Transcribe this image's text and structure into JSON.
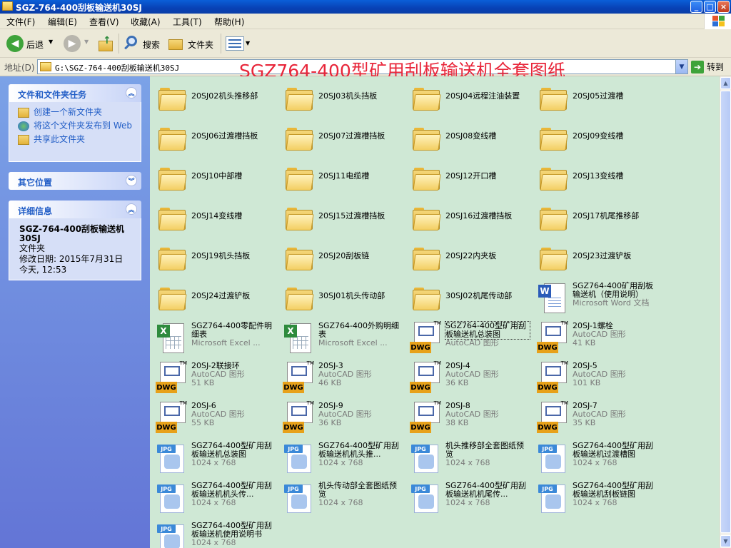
{
  "window": {
    "title": "SGZ-764-400刮板输送机30SJ",
    "minimize": "_",
    "maximize": "□",
    "close": "×"
  },
  "menu": [
    "文件(F)",
    "编辑(E)",
    "查看(V)",
    "收藏(A)",
    "工具(T)",
    "帮助(H)"
  ],
  "toolbar": {
    "back": "后退",
    "search": "搜索",
    "folders": "文件夹"
  },
  "address": {
    "label": "地址(D)",
    "path": "G:\\SGZ-764-400刮板输送机30SJ",
    "go": "转到"
  },
  "overlay_title": "SGZ764-400型矿用刮板输送机全套图纸",
  "taskpane": {
    "tasks_title": "文件和文件夹任务",
    "tasks": [
      "创建一个新文件夹",
      "将这个文件夹发布到 Web",
      "共享此文件夹"
    ],
    "other_title": "其它位置",
    "details_title": "详细信息",
    "details_name": "SGZ-764-400刮板输送机30SJ",
    "details_type": "文件夹",
    "details_modified": "修改日期: 2015年7月31日今天, 12:53"
  },
  "items": [
    {
      "type": "folder",
      "name": "20SJ02机头推移部"
    },
    {
      "type": "folder",
      "name": "20SJ03机头挡板"
    },
    {
      "type": "folder",
      "name": "20SJ04远程注油装置"
    },
    {
      "type": "folder",
      "name": "20SJ05过渡槽"
    },
    {
      "type": "folder",
      "name": "20SJ06过渡槽挡板"
    },
    {
      "type": "folder",
      "name": "20SJ07过渡槽挡板"
    },
    {
      "type": "folder",
      "name": "20SJ08变线槽"
    },
    {
      "type": "folder",
      "name": "20SJ09变线槽"
    },
    {
      "type": "folder",
      "name": "20SJ10中部槽"
    },
    {
      "type": "folder",
      "name": "20SJ11电缆槽"
    },
    {
      "type": "folder",
      "name": "20SJ12开口槽"
    },
    {
      "type": "folder",
      "name": "20SJ13变线槽"
    },
    {
      "type": "folder",
      "name": "20SJ14变线槽"
    },
    {
      "type": "folder",
      "name": "20SJ15过渡槽挡板"
    },
    {
      "type": "folder",
      "name": "20SJ16过渡槽挡板"
    },
    {
      "type": "folder",
      "name": "20SJ17机尾推移部"
    },
    {
      "type": "folder",
      "name": "20SJ19机头挡板"
    },
    {
      "type": "folder",
      "name": "20SJ20刮板链"
    },
    {
      "type": "folder",
      "name": "20SJ22内夹板"
    },
    {
      "type": "folder",
      "name": "20SJ23过渡铲板"
    },
    {
      "type": "folder",
      "name": "20SJ24过渡铲板"
    },
    {
      "type": "folder",
      "name": "30SJ01机头传动部"
    },
    {
      "type": "folder",
      "name": "30SJ02机尾传动部"
    },
    {
      "type": "doc",
      "name": "SGZ764-400矿用刮板输送机（使用说明）",
      "sub1": "Microsoft Word 文档",
      "sub2": ""
    },
    {
      "type": "xls",
      "name": "SGZ764-400零配件明细表",
      "sub1": "Microsoft Excel ...",
      "sub2": ""
    },
    {
      "type": "xls",
      "name": "SGZ764-400外购明细表",
      "sub1": "Microsoft Excel ...",
      "sub2": ""
    },
    {
      "type": "dwg",
      "name": "SGZ764-400型矿用刮板输送机总装图",
      "sub1": "AutoCAD 图形",
      "sub2": "",
      "selected": true
    },
    {
      "type": "dwg",
      "name": "20SJ-1螺栓",
      "sub1": "AutoCAD 图形",
      "sub2": "41 KB"
    },
    {
      "type": "dwg",
      "name": "20SJ-2联接环",
      "sub1": "AutoCAD 图形",
      "sub2": "51 KB"
    },
    {
      "type": "dwg",
      "name": "20SJ-3",
      "sub1": "AutoCAD 图形",
      "sub2": "46 KB"
    },
    {
      "type": "dwg",
      "name": "20SJ-4",
      "sub1": "AutoCAD 图形",
      "sub2": "36 KB"
    },
    {
      "type": "dwg",
      "name": "20SJ-5",
      "sub1": "AutoCAD 图形",
      "sub2": "101 KB"
    },
    {
      "type": "dwg",
      "name": "20SJ-6",
      "sub1": "AutoCAD 图形",
      "sub2": "55 KB"
    },
    {
      "type": "dwg",
      "name": "20SJ-9",
      "sub1": "AutoCAD 图形",
      "sub2": "36 KB"
    },
    {
      "type": "dwg",
      "name": "20SJ-8",
      "sub1": "AutoCAD 图形",
      "sub2": "38 KB"
    },
    {
      "type": "dwg",
      "name": "20SJ-7",
      "sub1": "AutoCAD 图形",
      "sub2": "35 KB"
    },
    {
      "type": "jpg",
      "name": "SGZ764-400型矿用刮板输送机总装图",
      "sub1": "1024 x 768",
      "sub2": ""
    },
    {
      "type": "jpg",
      "name": "SGZ764-400型矿用刮板输送机机头推...",
      "sub1": "1024 x 768",
      "sub2": ""
    },
    {
      "type": "jpg",
      "name": "机头推移部全套图纸预览",
      "sub1": "1024 x 768",
      "sub2": ""
    },
    {
      "type": "jpg",
      "name": "SGZ764-400型矿用刮板输送机过渡槽图",
      "sub1": "1024 x 768",
      "sub2": ""
    },
    {
      "type": "jpg",
      "name": "SGZ764-400型矿用刮板输送机机头传...",
      "sub1": "1024 x 768",
      "sub2": ""
    },
    {
      "type": "jpg",
      "name": "机头传动部全套图纸预览",
      "sub1": "1024 x 768",
      "sub2": ""
    },
    {
      "type": "jpg",
      "name": "SGZ764-400型矿用刮板输送机机尾传...",
      "sub1": "1024 x 768",
      "sub2": ""
    },
    {
      "type": "jpg",
      "name": "SGZ764-400型矿用刮板输送机刮板链图",
      "sub1": "1024 x 768",
      "sub2": ""
    },
    {
      "type": "jpg",
      "name": "SGZ764-400型矿用刮板输送机使用说明书",
      "sub1": "1024 x 768",
      "sub2": ""
    }
  ],
  "colors": {
    "content_bg": "#cfe8d5",
    "taskpane_bg": "#7ba2e7",
    "titlebar": "#0841b5",
    "overlay_text": "#e8263a"
  }
}
